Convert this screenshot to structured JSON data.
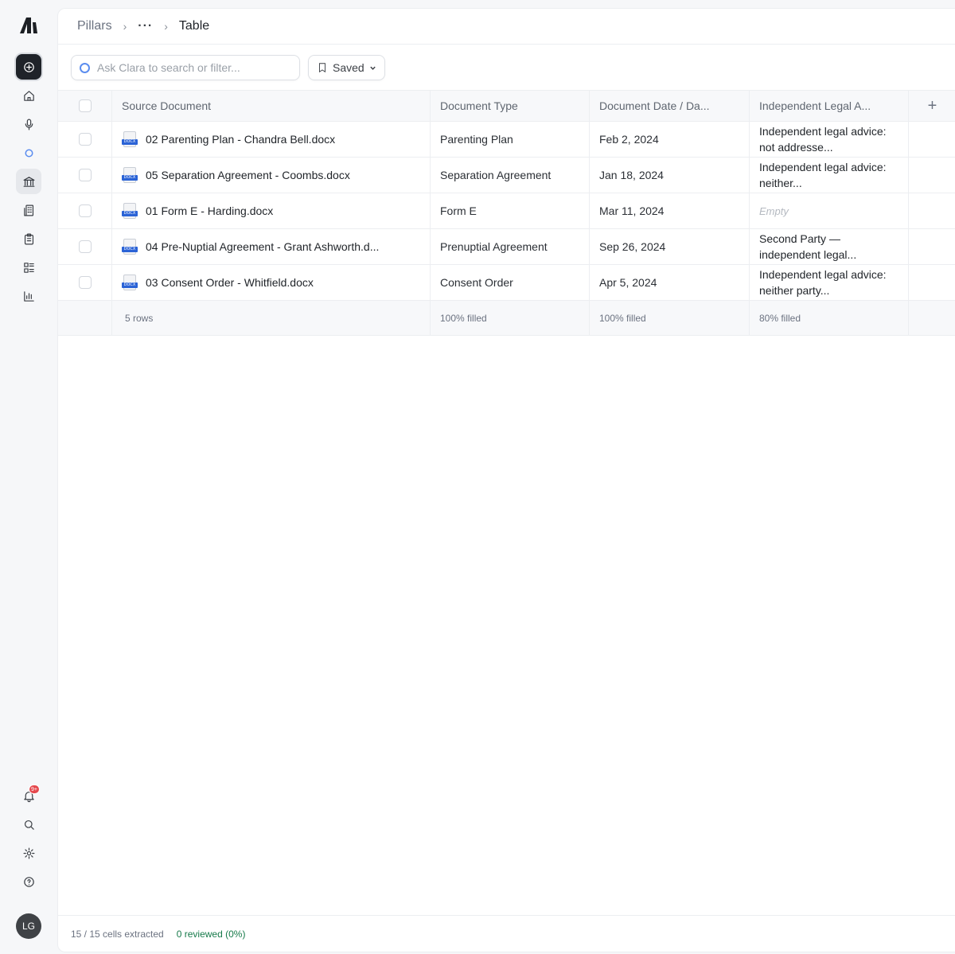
{
  "breadcrumb": {
    "root": "Pillars",
    "ellipsis": "···",
    "current": "Table"
  },
  "toolbar": {
    "search_placeholder": "Ask Clara to search or filter...",
    "saved_label": "Saved"
  },
  "sidebar": {
    "notifications_badge": "9+",
    "user_initials": "LG"
  },
  "table": {
    "columns": [
      "Source Document",
      "Document Type",
      "Document Date / Da...",
      "Independent Legal A..."
    ],
    "file_tag": "DOCX",
    "rows": [
      {
        "source": "02 Parenting Plan - Chandra Bell.docx",
        "type": "Parenting Plan",
        "date": "Feb 2, 2024",
        "legal": "Independent legal advice: not addresse..."
      },
      {
        "source": "05 Separation Agreement - Coombs.docx",
        "type": "Separation Agreement",
        "date": "Jan 18, 2024",
        "legal": "Independent legal advice: neither..."
      },
      {
        "source": "01 Form E - Harding.docx",
        "type": "Form E",
        "date": "Mar 11, 2024",
        "legal": "Empty"
      },
      {
        "source": "04 Pre-Nuptial Agreement - Grant Ashworth.d...",
        "type": "Prenuptial Agreement",
        "date": "Sep 26, 2024",
        "legal": "Second Party — independent legal..."
      },
      {
        "source": "03 Consent Order - Whitfield.docx",
        "type": "Consent Order",
        "date": "Apr 5, 2024",
        "legal": "Independent legal advice: neither party..."
      }
    ],
    "footer": {
      "row_count": "5 rows",
      "type_filled": "100% filled",
      "date_filled": "100% filled",
      "legal_filled": "80% filled"
    },
    "add_column": "+"
  },
  "status": {
    "extracted": "15 / 15 cells extracted",
    "reviewed": "0 reviewed (0%)"
  },
  "colors": {
    "accent_blue": "#2b63d6",
    "reviewed_green": "#167a4a",
    "badge_red": "#e5484d"
  }
}
